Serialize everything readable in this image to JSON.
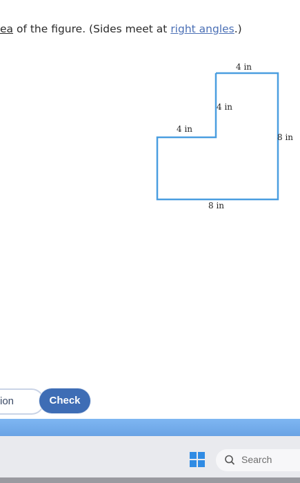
{
  "question": {
    "text_start": "ea",
    "text_mid": " of the figure. (Sides meet at ",
    "link": "right angles",
    "text_end": ".)"
  },
  "figure": {
    "labels": {
      "top": "4 in",
      "inner_vertical": "4 in",
      "left_ledge": "4 in",
      "right": "8 in",
      "bottom": "8 in"
    },
    "outline_color": "#4a9ee0"
  },
  "actions": {
    "left_button": "ion",
    "check_button": "Check"
  },
  "taskbar": {
    "search_placeholder": "Search"
  }
}
